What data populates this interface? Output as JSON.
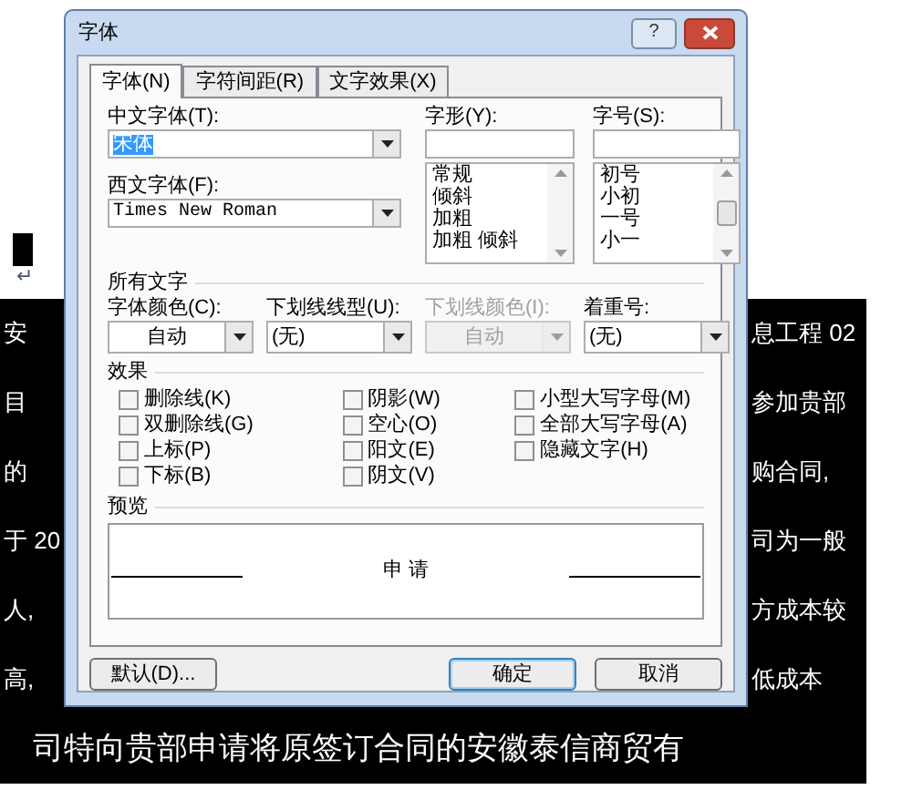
{
  "document": {
    "paragraph_mark": "↵",
    "lines": [
      {
        "left": "安",
        "right": "息工程 02"
      },
      {
        "left": "目",
        "right": "参加贵部"
      },
      {
        "left": "的",
        "right": "购合同,"
      },
      {
        "left": "于 20",
        "right": "司为一般"
      },
      {
        "left": "人,",
        "right": "方成本较"
      },
      {
        "left": "高,",
        "right": "低成本"
      },
      {
        "left": "司特向贵部申请将原签订合同的安徽泰信商贸有"
      }
    ]
  },
  "dialog": {
    "title": "字体",
    "help_button": "?",
    "tabs": [
      {
        "label": "字体(N)",
        "selected": true
      },
      {
        "label": "字符间距(R)",
        "selected": false
      },
      {
        "label": "文字效果(X)",
        "selected": false
      }
    ],
    "chinese_font": {
      "label": "中文字体(T):",
      "value": "宋体",
      "value_selected": true
    },
    "western_font": {
      "label": "西文字体(F):",
      "value": "Times New Roman",
      "value_selected": false
    },
    "font_style": {
      "label": "字形(Y):",
      "items": [
        "常规",
        "倾斜",
        "加粗",
        "加粗 倾斜"
      ]
    },
    "font_size": {
      "label": "字号(S):",
      "items": [
        "初号",
        "小初",
        "一号",
        "小一"
      ]
    },
    "all_text": {
      "heading": "所有文字",
      "fields": [
        {
          "label": "字体颜色(C):",
          "value": "自动",
          "disabled": false,
          "centered": true
        },
        {
          "label": "下划线线型(U):",
          "value": "(无)",
          "disabled": false,
          "centered": false
        },
        {
          "label": "下划线颜色(I):",
          "value": "自动",
          "disabled": true,
          "centered": true
        },
        {
          "label": "着重号:",
          "value": "(无)",
          "disabled": false,
          "centered": false
        }
      ]
    },
    "effects": {
      "heading": "效果",
      "columns": [
        [
          {
            "label": "删除线(K)",
            "checked": false
          },
          {
            "label": "双删除线(G)",
            "checked": false
          },
          {
            "label": "上标(P)",
            "checked": false
          },
          {
            "label": "下标(B)",
            "checked": false
          }
        ],
        [
          {
            "label": "阴影(W)",
            "checked": false
          },
          {
            "label": "空心(O)",
            "checked": false
          },
          {
            "label": "阳文(E)",
            "checked": false
          },
          {
            "label": "阴文(V)",
            "checked": false
          }
        ],
        [
          {
            "label": "小型大写字母(M)",
            "checked": false
          },
          {
            "label": "全部大写字母(A)",
            "checked": false
          },
          {
            "label": "隐藏文字(H)",
            "checked": false
          }
        ]
      ]
    },
    "preview": {
      "heading": "预览",
      "sample": "申 请"
    },
    "buttons": [
      {
        "label": "默认(D)...",
        "kind": "secondary"
      },
      {
        "label": "确定",
        "kind": "default"
      },
      {
        "label": "取消",
        "kind": "secondary"
      }
    ]
  }
}
